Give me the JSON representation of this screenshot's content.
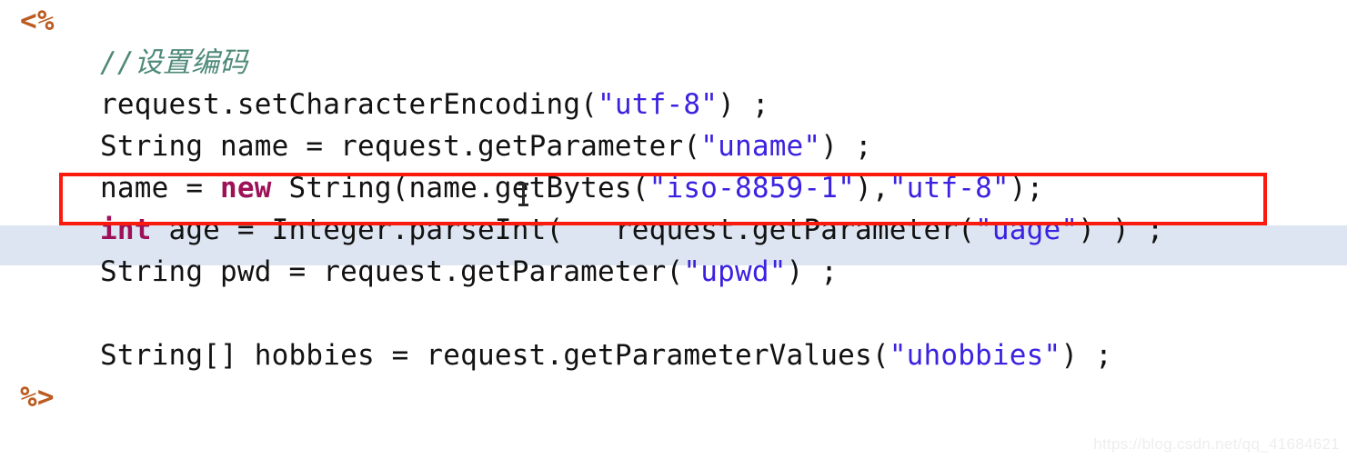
{
  "editor": {
    "language": "jsp",
    "background_color": "#ffffff",
    "default_text_color": "#101010",
    "highlight_line_color": "#dde5f2",
    "annotation_box_color": "#fb1b0e",
    "string_color": "#3b22e0",
    "keyword_color": "#9d1159",
    "comment_color": "#4f8a79",
    "jsp_tag_color": "#bc5b20",
    "lines": [
      {
        "indent": 0,
        "text": "<%"
      },
      {
        "indent": 1,
        "text": "//设置编码"
      },
      {
        "indent": 1,
        "text": "request.setCharacterEncoding(\"utf-8\") ;"
      },
      {
        "indent": 1,
        "text": "String name = request.getParameter(\"uname\") ;"
      },
      {
        "indent": 1,
        "text": "name = new String(name.getBytes(\"iso-8859-1\"),\"utf-8\");"
      },
      {
        "indent": 1,
        "text": "int age = Integer.parseInt(   request.getParameter(\"uage\") ) ;"
      },
      {
        "indent": 1,
        "text": "String pwd = request.getParameter(\"upwd\") ;"
      },
      {
        "indent": 1,
        "text": ""
      },
      {
        "indent": 1,
        "text": "String[] hobbies = request.getParameterValues(\"uhobbies\") ;"
      },
      {
        "indent": 0,
        "text": "%>"
      }
    ],
    "tokens": {
      "jsp_open": "<%",
      "jsp_close": "%>",
      "comment": "//设置编码",
      "line_request_encoding": {
        "before": "request.setCharacterEncoding(",
        "string": "\"utf-8\"",
        "after": ") ;"
      },
      "line_name": {
        "before": "String name = request.getParameter(",
        "string": "\"uname\"",
        "after": ") ;"
      },
      "line_name_recode": {
        "p1": "name = ",
        "kw": "new",
        "p2": " String(name.getBytes(",
        "s1": "\"iso-8859-1\"",
        "p3": "),",
        "s2": "\"utf-8\"",
        "p4": ");"
      },
      "line_age": {
        "kw": "int",
        "p1": " age = Integer.parseInt(   request.getParameter(",
        "s1": "\"uage\"",
        "p2": ") ) ;"
      },
      "line_pwd": {
        "before": "String pwd = request.getParameter(",
        "string": "\"upwd\"",
        "after": ") ;"
      },
      "line_hobbies": {
        "before": "String[] hobbies = request.getParameterValues(",
        "string": "\"uhobbies\"",
        "after": ") ;"
      }
    }
  },
  "annotation": {
    "box_label": "red-highlight-rectangle",
    "target_line": "name = new String(name.getBytes(\"iso-8859-1\"),\"utf-8\");"
  },
  "cursor": {
    "type": "text-ibeam"
  },
  "watermark": {
    "text": "https://blog.csdn.net/qq_41684621"
  }
}
